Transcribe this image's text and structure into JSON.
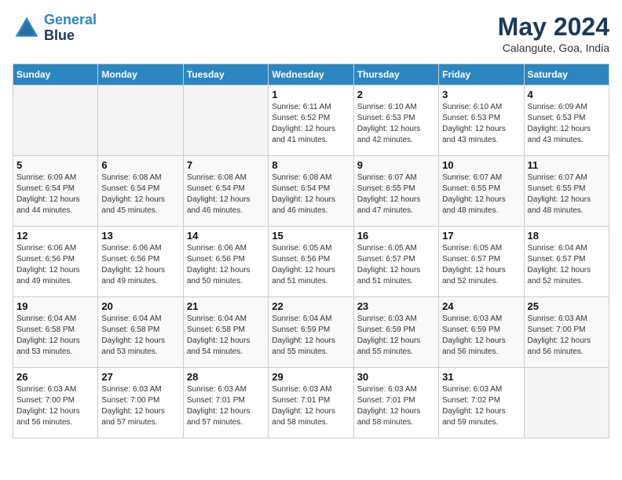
{
  "header": {
    "logo_line1": "General",
    "logo_line2": "Blue",
    "month": "May 2024",
    "location": "Calangute, Goa, India"
  },
  "weekdays": [
    "Sunday",
    "Monday",
    "Tuesday",
    "Wednesday",
    "Thursday",
    "Friday",
    "Saturday"
  ],
  "weeks": [
    [
      {
        "day": "",
        "info": ""
      },
      {
        "day": "",
        "info": ""
      },
      {
        "day": "",
        "info": ""
      },
      {
        "day": "1",
        "info": "Sunrise: 6:11 AM\nSunset: 6:52 PM\nDaylight: 12 hours\nand 41 minutes."
      },
      {
        "day": "2",
        "info": "Sunrise: 6:10 AM\nSunset: 6:53 PM\nDaylight: 12 hours\nand 42 minutes."
      },
      {
        "day": "3",
        "info": "Sunrise: 6:10 AM\nSunset: 6:53 PM\nDaylight: 12 hours\nand 43 minutes."
      },
      {
        "day": "4",
        "info": "Sunrise: 6:09 AM\nSunset: 6:53 PM\nDaylight: 12 hours\nand 43 minutes."
      }
    ],
    [
      {
        "day": "5",
        "info": "Sunrise: 6:09 AM\nSunset: 6:54 PM\nDaylight: 12 hours\nand 44 minutes."
      },
      {
        "day": "6",
        "info": "Sunrise: 6:08 AM\nSunset: 6:54 PM\nDaylight: 12 hours\nand 45 minutes."
      },
      {
        "day": "7",
        "info": "Sunrise: 6:08 AM\nSunset: 6:54 PM\nDaylight: 12 hours\nand 46 minutes."
      },
      {
        "day": "8",
        "info": "Sunrise: 6:08 AM\nSunset: 6:54 PM\nDaylight: 12 hours\nand 46 minutes."
      },
      {
        "day": "9",
        "info": "Sunrise: 6:07 AM\nSunset: 6:55 PM\nDaylight: 12 hours\nand 47 minutes."
      },
      {
        "day": "10",
        "info": "Sunrise: 6:07 AM\nSunset: 6:55 PM\nDaylight: 12 hours\nand 48 minutes."
      },
      {
        "day": "11",
        "info": "Sunrise: 6:07 AM\nSunset: 6:55 PM\nDaylight: 12 hours\nand 48 minutes."
      }
    ],
    [
      {
        "day": "12",
        "info": "Sunrise: 6:06 AM\nSunset: 6:56 PM\nDaylight: 12 hours\nand 49 minutes."
      },
      {
        "day": "13",
        "info": "Sunrise: 6:06 AM\nSunset: 6:56 PM\nDaylight: 12 hours\nand 49 minutes."
      },
      {
        "day": "14",
        "info": "Sunrise: 6:06 AM\nSunset: 6:56 PM\nDaylight: 12 hours\nand 50 minutes."
      },
      {
        "day": "15",
        "info": "Sunrise: 6:05 AM\nSunset: 6:56 PM\nDaylight: 12 hours\nand 51 minutes."
      },
      {
        "day": "16",
        "info": "Sunrise: 6:05 AM\nSunset: 6:57 PM\nDaylight: 12 hours\nand 51 minutes."
      },
      {
        "day": "17",
        "info": "Sunrise: 6:05 AM\nSunset: 6:57 PM\nDaylight: 12 hours\nand 52 minutes."
      },
      {
        "day": "18",
        "info": "Sunrise: 6:04 AM\nSunset: 6:57 PM\nDaylight: 12 hours\nand 52 minutes."
      }
    ],
    [
      {
        "day": "19",
        "info": "Sunrise: 6:04 AM\nSunset: 6:58 PM\nDaylight: 12 hours\nand 53 minutes."
      },
      {
        "day": "20",
        "info": "Sunrise: 6:04 AM\nSunset: 6:58 PM\nDaylight: 12 hours\nand 53 minutes."
      },
      {
        "day": "21",
        "info": "Sunrise: 6:04 AM\nSunset: 6:58 PM\nDaylight: 12 hours\nand 54 minutes."
      },
      {
        "day": "22",
        "info": "Sunrise: 6:04 AM\nSunset: 6:59 PM\nDaylight: 12 hours\nand 55 minutes."
      },
      {
        "day": "23",
        "info": "Sunrise: 6:03 AM\nSunset: 6:59 PM\nDaylight: 12 hours\nand 55 minutes."
      },
      {
        "day": "24",
        "info": "Sunrise: 6:03 AM\nSunset: 6:59 PM\nDaylight: 12 hours\nand 56 minutes."
      },
      {
        "day": "25",
        "info": "Sunrise: 6:03 AM\nSunset: 7:00 PM\nDaylight: 12 hours\nand 56 minutes."
      }
    ],
    [
      {
        "day": "26",
        "info": "Sunrise: 6:03 AM\nSunset: 7:00 PM\nDaylight: 12 hours\nand 56 minutes."
      },
      {
        "day": "27",
        "info": "Sunrise: 6:03 AM\nSunset: 7:00 PM\nDaylight: 12 hours\nand 57 minutes."
      },
      {
        "day": "28",
        "info": "Sunrise: 6:03 AM\nSunset: 7:01 PM\nDaylight: 12 hours\nand 57 minutes."
      },
      {
        "day": "29",
        "info": "Sunrise: 6:03 AM\nSunset: 7:01 PM\nDaylight: 12 hours\nand 58 minutes."
      },
      {
        "day": "30",
        "info": "Sunrise: 6:03 AM\nSunset: 7:01 PM\nDaylight: 12 hours\nand 58 minutes."
      },
      {
        "day": "31",
        "info": "Sunrise: 6:03 AM\nSunset: 7:02 PM\nDaylight: 12 hours\nand 59 minutes."
      },
      {
        "day": "",
        "info": ""
      }
    ]
  ]
}
